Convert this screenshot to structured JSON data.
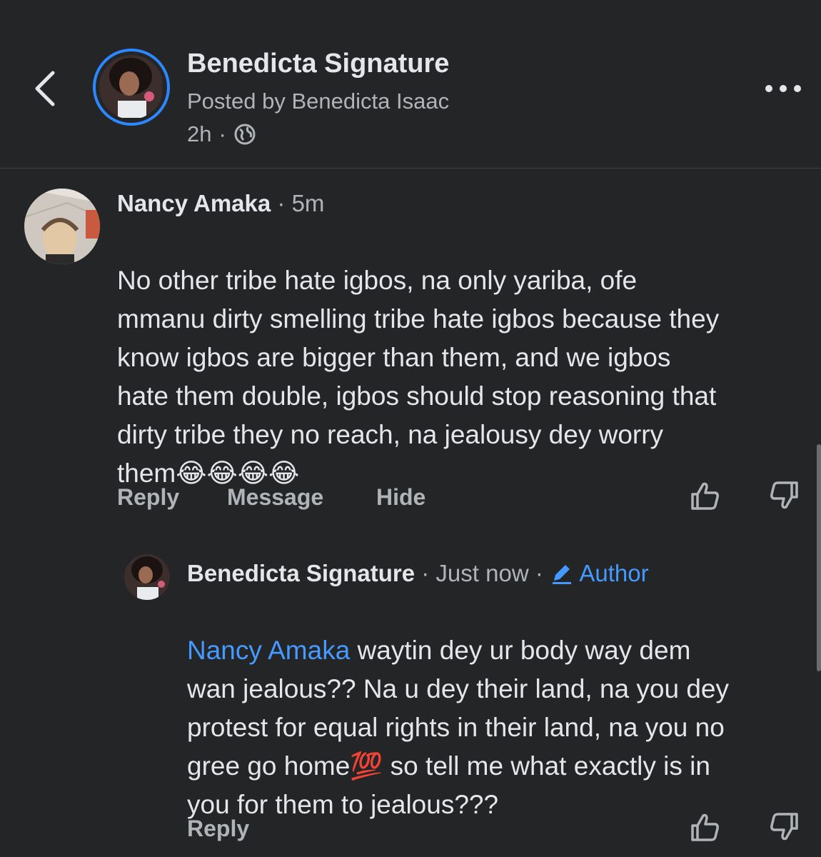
{
  "header": {
    "title": "Benedicta Signature",
    "posted_by": "Posted by Benedicta Isaac",
    "time": "2h",
    "separator": "·",
    "back_icon": "chevron-left-icon",
    "privacy_icon": "globe-icon",
    "more_icon": "more-horizontal-icon"
  },
  "comments": [
    {
      "author": "Nancy Amaka",
      "separator": "·",
      "time": "5m",
      "text": "No other tribe hate igbos, na only yariba, ofe\nmmanu dirty smelling tribe hate igbos because they\nknow igbos are bigger than them, and we igbos\nhate them double, igbos should stop reasoning that\ndirty tribe they no reach, na jealousy dey worry\nthem",
      "emoji": "😂😂😂😂",
      "actions": [
        "Reply",
        "Message",
        "Hide"
      ],
      "like_icon": "thumbs-up-icon",
      "dislike_icon": "thumbs-down-icon"
    }
  ],
  "reply": {
    "author": "Benedicta Signature",
    "separator": "·",
    "time": "Just now",
    "badge_label": "Author",
    "badge_icon": "pencil-icon",
    "mention": "Nancy Amaka",
    "text_line1": " waytin dey ur body way dem",
    "text_line2": "wan jealous?? Na u dey their land, na you dey",
    "text_line3": "protest for equal rights in their land, na you no",
    "text_line4a": "gree go home",
    "text_emoji": "💯",
    "text_line4b": "  so tell me what exactly is in",
    "text_line5": "you for them to jealous???",
    "action": "Reply",
    "like_icon": "thumbs-up-icon",
    "dislike_icon": "thumbs-down-icon"
  },
  "colors": {
    "background": "#242526",
    "text": "#e4e6eb",
    "secondary": "#b0b3b8",
    "accent": "#4599ff",
    "avatar_ring": "#2d88ff"
  }
}
